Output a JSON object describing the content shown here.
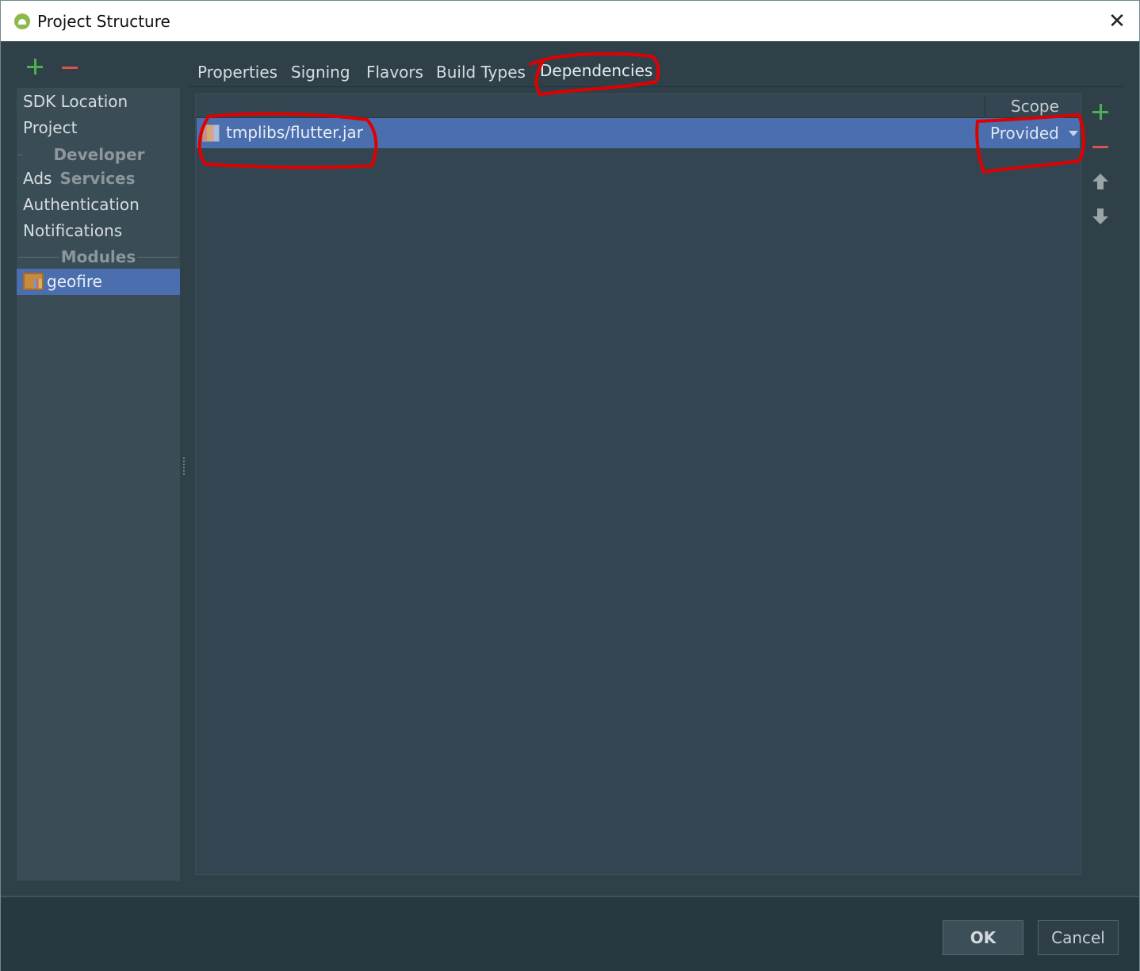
{
  "window": {
    "title": "Project Structure",
    "logo_icon": "android-studio-icon",
    "close_icon": "close-icon"
  },
  "toolbar": {
    "add_icon": "plus-icon",
    "remove_icon": "minus-icon"
  },
  "sidebar": {
    "items": [
      {
        "label": "SDK Location"
      },
      {
        "label": "Project"
      }
    ],
    "developer_services_header": "Developer Services",
    "developer_services": [
      {
        "label": "Ads"
      },
      {
        "label": "Authentication"
      },
      {
        "label": "Notifications"
      }
    ],
    "modules_header": "Modules",
    "modules": [
      {
        "label": "geofire",
        "selected": true,
        "icon": "module-icon"
      }
    ]
  },
  "tabs": [
    {
      "label": "Properties"
    },
    {
      "label": "Signing"
    },
    {
      "label": "Flavors"
    },
    {
      "label": "Build Types"
    },
    {
      "label": "Dependencies",
      "active": true
    }
  ],
  "dependencies": {
    "column_scope": "Scope",
    "rows": [
      {
        "name": "tmplibs/flutter.jar",
        "scope": "Provided",
        "icon": "jar-library-icon",
        "selected": true
      }
    ]
  },
  "side_actions": {
    "add_icon": "plus-icon",
    "remove_icon": "minus-icon",
    "up_icon": "arrow-up-icon",
    "down_icon": "arrow-down-icon"
  },
  "footer": {
    "ok_label": "OK",
    "cancel_label": "Cancel"
  },
  "colors": {
    "selection": "#4b6eaf",
    "add": "#4caf50",
    "remove": "#d9534f",
    "annotation": "#e00000"
  }
}
